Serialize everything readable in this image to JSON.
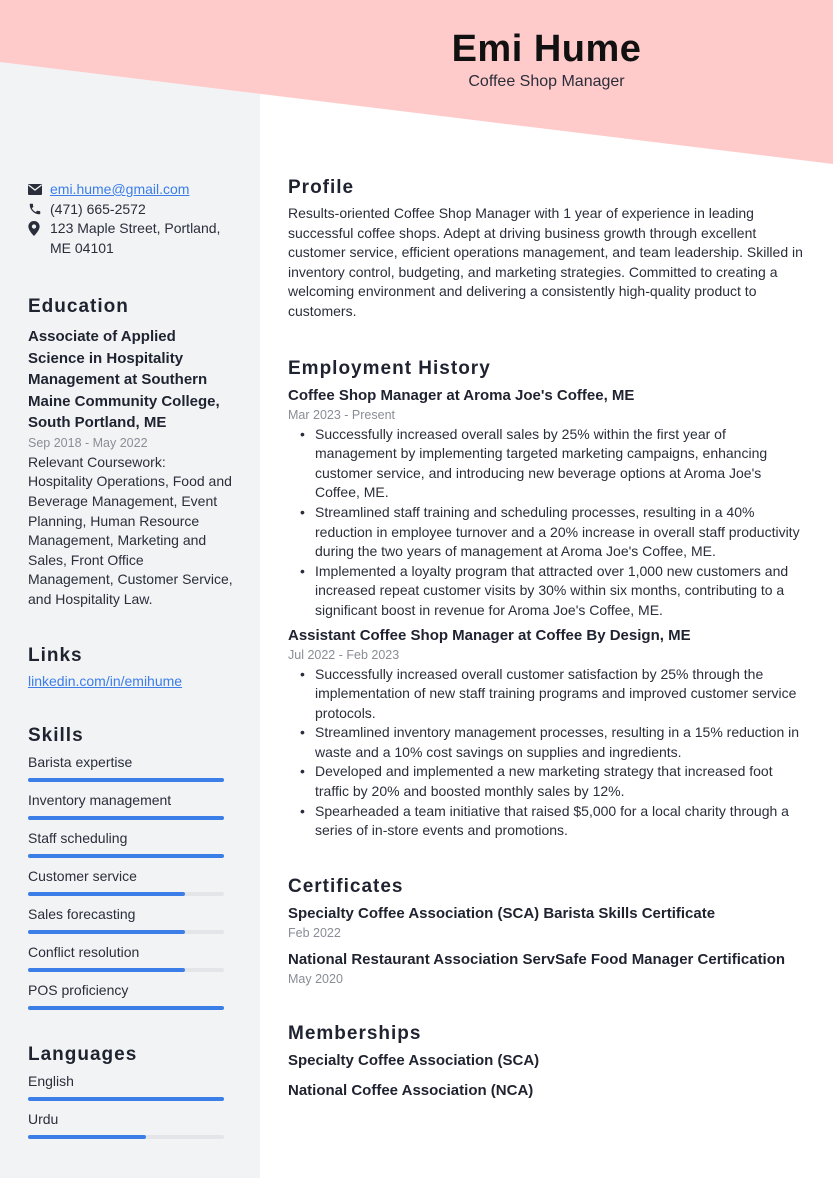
{
  "header": {
    "name": "Emi Hume",
    "title": "Coffee Shop Manager",
    "accent_color": "#ffcaca"
  },
  "contact": {
    "email": "emi.hume@gmail.com",
    "phone": "(471) 665-2572",
    "address": "123 Maple Street, Portland, ME 04101",
    "email_icon": "envelope-icon",
    "phone_icon": "phone-icon",
    "address_icon": "map-pin-icon"
  },
  "education": {
    "heading": "Education",
    "degree": "Associate of Applied Science in Hospitality Management at Southern Maine Community College, South Portland, ME",
    "dates": "Sep 2018 - May 2022",
    "description": "Relevant Coursework: Hospitality Operations, Food and Beverage Management, Event Planning, Human Resource Management, Marketing and Sales, Front Office Management, Customer Service, and Hospitality Law."
  },
  "links": {
    "heading": "Links",
    "items": [
      {
        "label": "linkedin.com/in/emihume"
      }
    ]
  },
  "skills": {
    "heading": "Skills",
    "bar_color": "#3b7ee8",
    "items": [
      {
        "label": "Barista expertise",
        "level": 1.0
      },
      {
        "label": "Inventory management",
        "level": 1.0
      },
      {
        "label": "Staff scheduling",
        "level": 1.0
      },
      {
        "label": "Customer service",
        "level": 0.8
      },
      {
        "label": "Sales forecasting",
        "level": 0.8
      },
      {
        "label": "Conflict resolution",
        "level": 0.8
      },
      {
        "label": "POS proficiency",
        "level": 1.0
      }
    ]
  },
  "languages": {
    "heading": "Languages",
    "items": [
      {
        "label": "English",
        "level": 1.0
      },
      {
        "label": "Urdu",
        "level": 0.6
      }
    ]
  },
  "profile": {
    "heading": "Profile",
    "text": "Results-oriented Coffee Shop Manager with 1 year of experience in leading successful coffee shops. Adept at driving business growth through excellent customer service, efficient operations management, and team leadership. Skilled in inventory control, budgeting, and marketing strategies. Committed to creating a welcoming environment and delivering a consistently high-quality product to customers."
  },
  "employment": {
    "heading": "Employment History",
    "jobs": [
      {
        "title": "Coffee Shop Manager at Aroma Joe's Coffee, ME",
        "dates": "Mar 2023 - Present",
        "bullets": [
          "Successfully increased overall sales by 25% within the first year of management by implementing targeted marketing campaigns, enhancing customer service, and introducing new beverage options at Aroma Joe's Coffee, ME.",
          "Streamlined staff training and scheduling processes, resulting in a 40% reduction in employee turnover and a 20% increase in overall staff productivity during the two years of management at Aroma Joe's Coffee, ME.",
          "Implemented a loyalty program that attracted over 1,000 new customers and increased repeat customer visits by 30% within six months, contributing to a significant boost in revenue for Aroma Joe's Coffee, ME."
        ]
      },
      {
        "title": "Assistant Coffee Shop Manager at Coffee By Design, ME",
        "dates": "Jul 2022 - Feb 2023",
        "bullets": [
          "Successfully increased overall customer satisfaction by 25% through the implementation of new staff training programs and improved customer service protocols.",
          "Streamlined inventory management processes, resulting in a 15% reduction in waste and a 10% cost savings on supplies and ingredients.",
          "Developed and implemented a new marketing strategy that increased foot traffic by 20% and boosted monthly sales by 12%.",
          "Spearheaded a team initiative that raised $5,000 for a local charity through a series of in-store events and promotions."
        ]
      }
    ]
  },
  "certificates": {
    "heading": "Certificates",
    "items": [
      {
        "title": "Specialty Coffee Association (SCA) Barista Skills Certificate",
        "date": "Feb 2022"
      },
      {
        "title": "National Restaurant Association ServSafe Food Manager Certification",
        "date": "May 2020"
      }
    ]
  },
  "memberships": {
    "heading": "Memberships",
    "items": [
      {
        "title": "Specialty Coffee Association (SCA)"
      },
      {
        "title": "National Coffee Association (NCA)"
      }
    ]
  }
}
